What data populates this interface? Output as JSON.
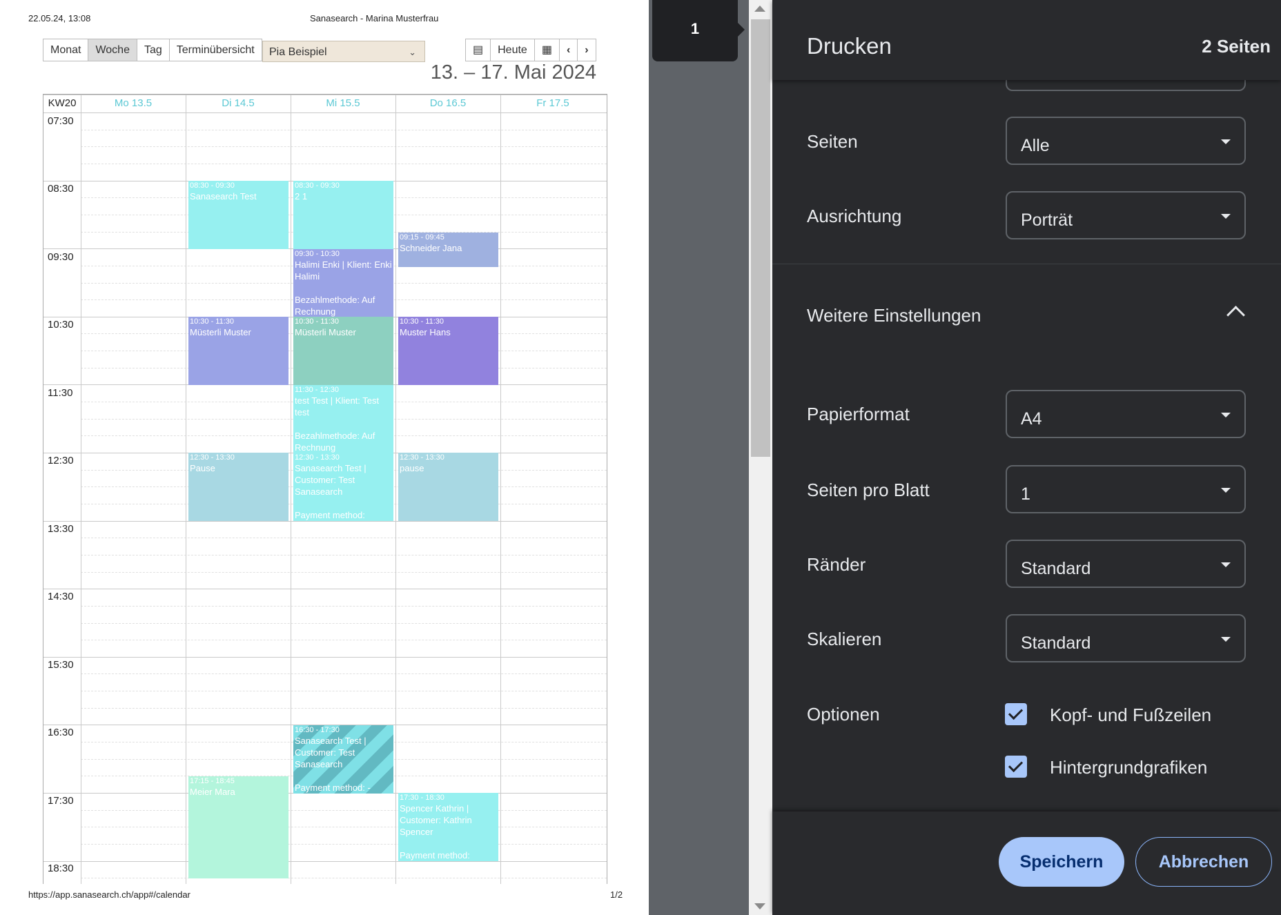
{
  "preview": {
    "print_datetime": "22.05.24, 13:08",
    "print_title": "Sanasearch - Marina Musterfrau",
    "view_buttons": [
      "Monat",
      "Woche",
      "Tag",
      "Terminübersicht"
    ],
    "person_select": "Pia Beispiel",
    "nav_today": "Heute",
    "date_range": "13. – 17. Mai 2024",
    "week_label": "KW20",
    "days": [
      "Mo 13.5",
      "Di 14.5",
      "Mi 15.5",
      "Do 16.5",
      "Fr 17.5"
    ],
    "times": [
      "07:30",
      "08:30",
      "09:30",
      "10:30",
      "11:30",
      "12:30",
      "13:30",
      "14:30",
      "15:30",
      "16:30",
      "17:30",
      "18:30"
    ],
    "events": [
      {
        "time": "08:30 - 09:30",
        "title": "Sanasearch Test"
      },
      {
        "time": "08:30 - 09:30",
        "title": "2 1"
      },
      {
        "time": "09:15 - 09:45",
        "title": "Schneider Jana"
      },
      {
        "time": "09:30 - 10:30",
        "title": "Halimi Enki | Klient: Enki Halimi\n\nBezahlmethode: Auf Rechnung"
      },
      {
        "time": "10:30 - 11:30",
        "title": "Müsterli Muster"
      },
      {
        "time": "10:30 - 11:30",
        "title": "Müsterli Muster"
      },
      {
        "time": "10:30 - 11:30",
        "title": "Muster Hans"
      },
      {
        "time": "11:30 - 12:30",
        "title": "test Test | Klient: Test test\n\nBezahlmethode: Auf Rechnung"
      },
      {
        "time": "12:30 - 13:30",
        "title": "Pause"
      },
      {
        "time": "12:30 - 13:30",
        "title": "Sanasearch Test | Customer: Test Sanasearch\n\nPayment method:"
      },
      {
        "time": "12:30 - 13:30",
        "title": "pause"
      },
      {
        "time": "16:30 - 17:30",
        "title": "Sanasearch Test | Customer: Test Sanasearch\n\nPayment method: -"
      },
      {
        "time": "17:15 - 18:45",
        "title": "Meier Mara"
      },
      {
        "time": "17:30 - 18:30",
        "title": "Spencer Kathrin | Customer: Kathrin Spencer\n\nPayment method:"
      }
    ],
    "footer_url": "https://app.sanasearch.ch/app#/calendar",
    "page_indicator": "1/2"
  },
  "thumbnail_page": "1",
  "panel": {
    "title": "Drucken",
    "page_count": "2 Seiten",
    "pages_label": "Seiten",
    "pages_value": "Alle",
    "orientation_label": "Ausrichtung",
    "orientation_value": "Porträt",
    "more_settings": "Weitere Einstellungen",
    "paper_label": "Papierformat",
    "paper_value": "A4",
    "per_sheet_label": "Seiten pro Blatt",
    "per_sheet_value": "1",
    "margins_label": "Ränder",
    "margins_value": "Standard",
    "scale_label": "Skalieren",
    "scale_value": "Standard",
    "options_label": "Optionen",
    "option_headers": "Kopf- und Fußzeilen",
    "option_background": "Hintergrundgrafiken",
    "save": "Speichern",
    "cancel": "Abbrechen"
  },
  "colors": {
    "panel_bg": "#292a2d",
    "accent": "#a8c7fa",
    "day_header": "#5bc8d4"
  }
}
